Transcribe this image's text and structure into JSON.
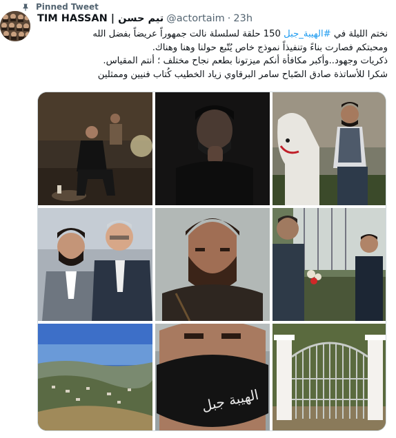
{
  "pinned_label": "Pinned Tweet",
  "author": {
    "display_name_en": "TIM HASSAN",
    "separator": "|",
    "display_name_ar": "تيم حسن",
    "handle": "@actortaim",
    "dot": "·",
    "time": "23h"
  },
  "text": {
    "line1_pre": "نختم الليلة في ",
    "hashtag": "#الهيبة_جبل",
    "line1_post": " 150 حلقة لسلسلة نالت جمهوراً عريضاً بفضل الله",
    "line2": "ومحبتكم فصارت بناءً وتنفيذاً نموذج خاص يُتّبع حولنا وهنا وهناك.",
    "line3": "ذكريات وجهود..وأكبر مكافأة أنكم ميزتونا بطعم نجاح مختلف ؛ أنتم المقياس.",
    "line4": "شكرا للأساتذة صادق الصّباح سامر البرقاوي زياد الخطيب كُتاب فنيين وممثلين"
  },
  "media": {
    "photo_count": 9,
    "mask_lettering": "الهيبة جبل"
  },
  "colors": {
    "link": "#1d9bf0",
    "secondary": "#536471",
    "border": "#cfd9de"
  }
}
